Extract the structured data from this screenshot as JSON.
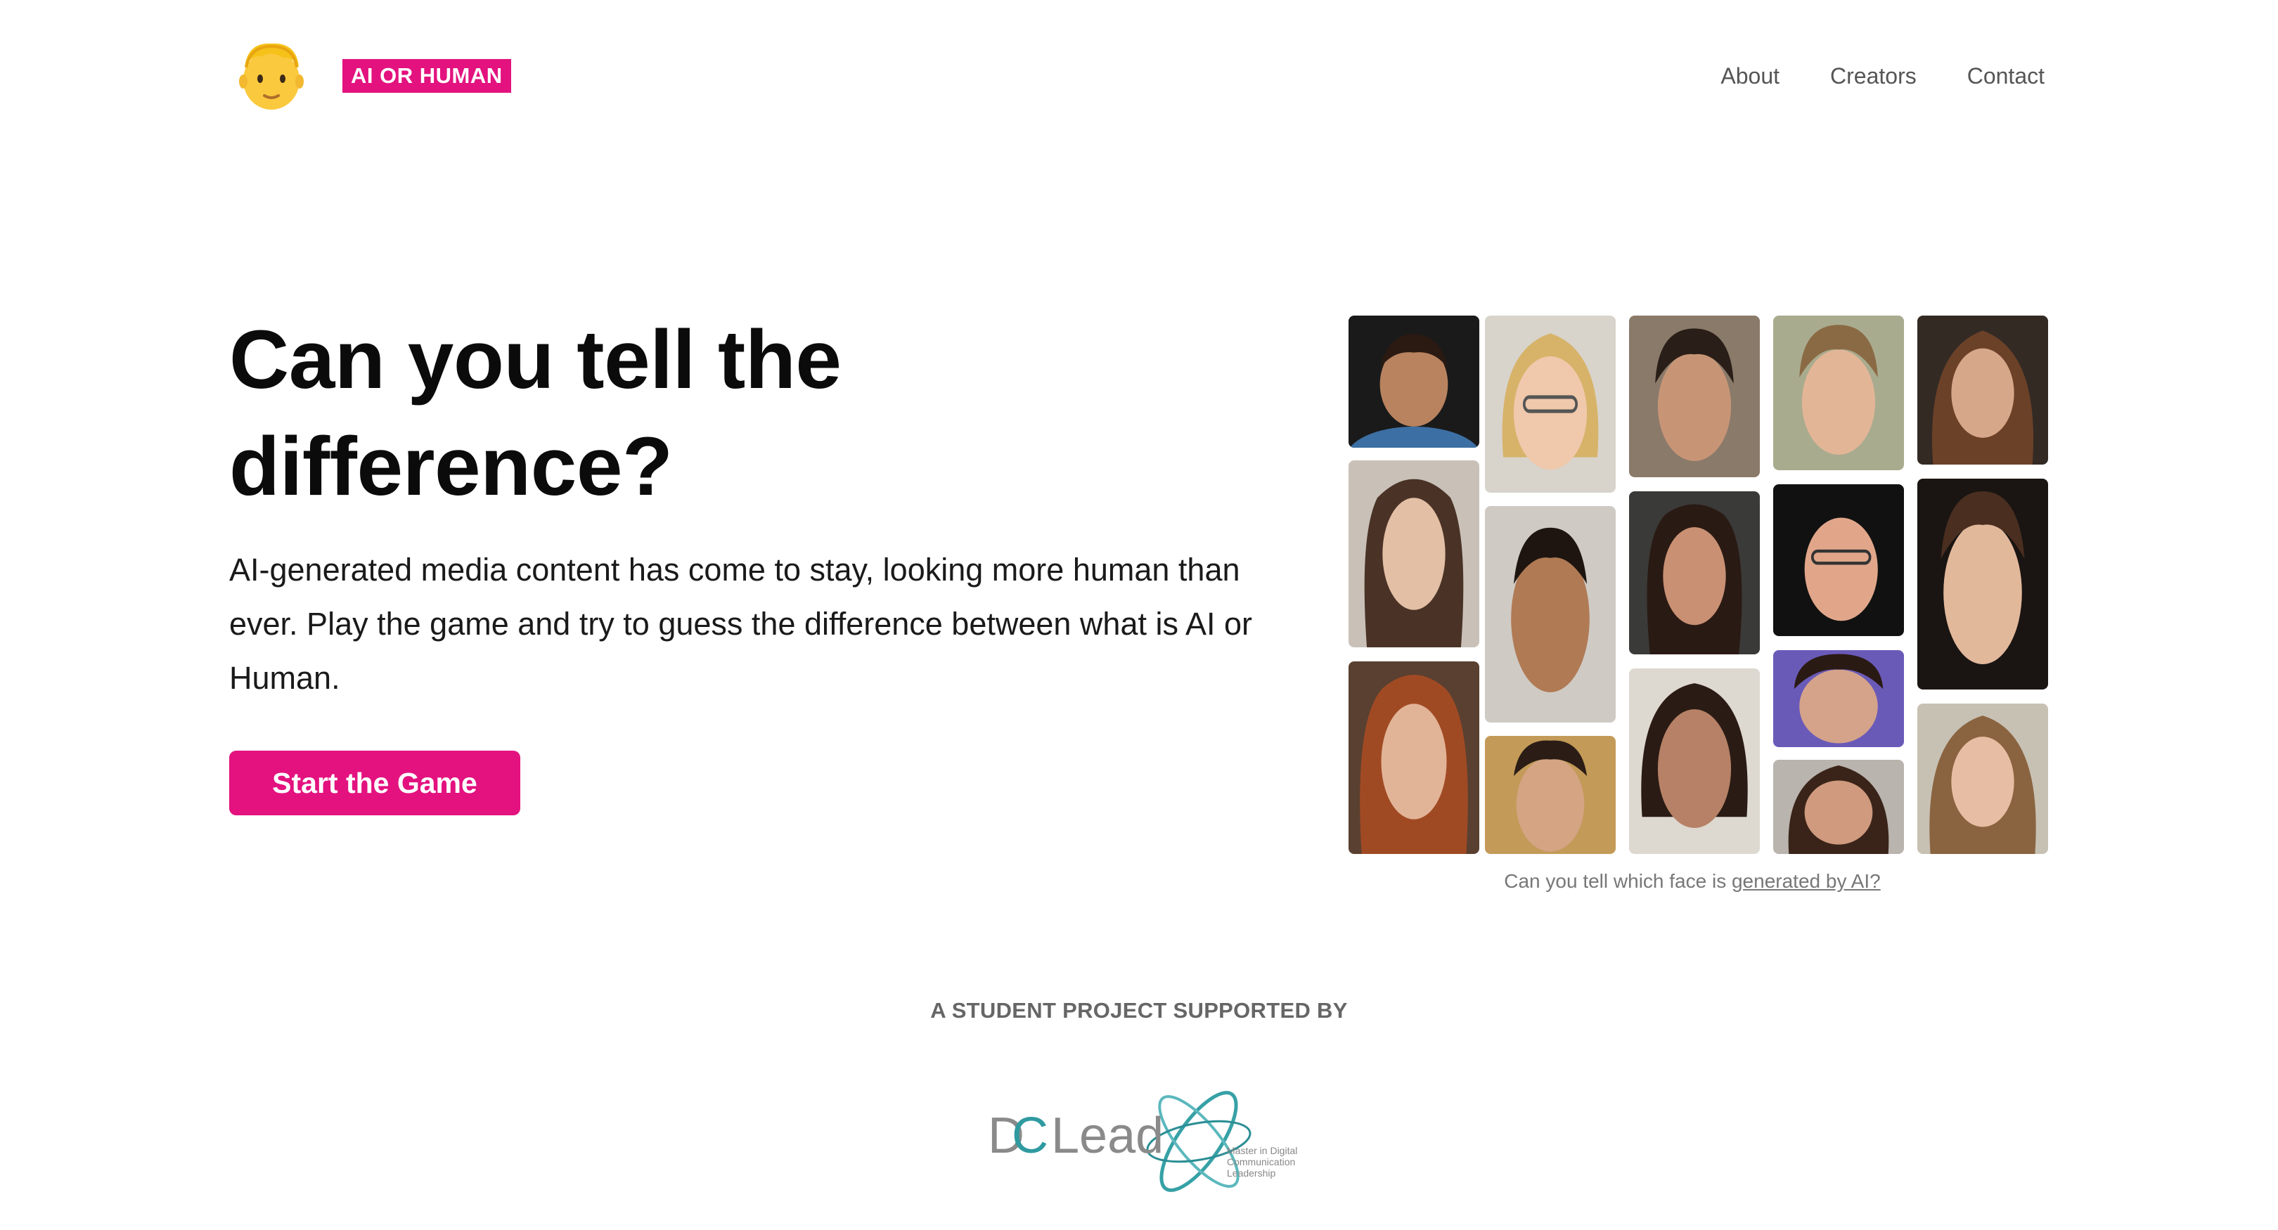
{
  "header": {
    "logo_icon": "man-face-emoji-icon",
    "brand": "AI OR HUMAN",
    "nav": [
      "About",
      "Creators",
      "Contact"
    ]
  },
  "hero": {
    "title": "Can you tell the difference?",
    "description": "AI-generated media content has come to stay, looking more human than ever. Play the game and try to guess the difference between what is AI or Human.",
    "cta_label": "Start the Game"
  },
  "gallery": {
    "caption_prefix": "Can you tell which face is ",
    "caption_link": "generated by AI?",
    "accent_color": "#e3127f"
  },
  "footer": {
    "support_label": "A STUDENT PROJECT SUPPORTED BY",
    "partner_logo": {
      "name": "DCLead",
      "tagline": "Master in Digital Communication Leadership"
    }
  }
}
